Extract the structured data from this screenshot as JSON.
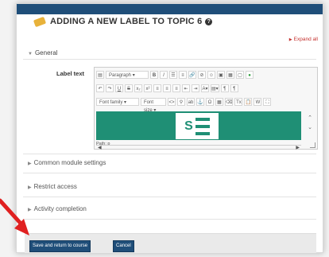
{
  "heading": {
    "title": "ADDING A NEW LABEL TO TOPIC 6",
    "help_icon": "?"
  },
  "expand_all": "Expand all",
  "general": {
    "title": "General"
  },
  "form": {
    "label_text": "Label text"
  },
  "editor": {
    "paragraph_select": "Paragraph",
    "font_family_select": "Font family",
    "font_size_select": "Font size",
    "path_label": "Path: p",
    "logo_letter": "S"
  },
  "sections": [
    {
      "title": "Common module settings"
    },
    {
      "title": "Restrict access"
    },
    {
      "title": "Activity completion"
    }
  ],
  "buttons": {
    "save_return": "Save and return to course",
    "cancel": "Cancel"
  },
  "colors": {
    "navy": "#1f4e79",
    "teal": "#1f8f75",
    "arrow": "#e02020",
    "link": "#c4312e"
  }
}
